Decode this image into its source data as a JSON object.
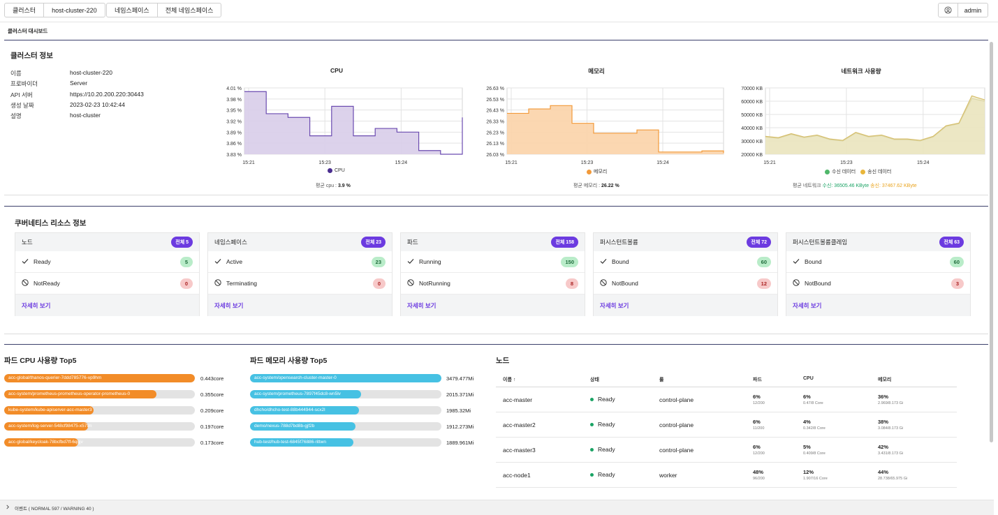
{
  "topbar": {
    "cluster_label": "클러스터",
    "cluster_value": "host-cluster-220",
    "namespace_label": "네임스페이스",
    "namespace_value": "전체 네임스페이스",
    "user_icon": "user-circle-icon",
    "user_name": "admin"
  },
  "page_subtitle": "클러스터 대시보드",
  "cluster_info": {
    "title": "클러스터 정보",
    "rows": [
      {
        "key": "이름",
        "value": "host-cluster-220"
      },
      {
        "key": "프로바이더",
        "value": "Server"
      },
      {
        "key": "API 서버",
        "value": "https://10.20.200.220:30443"
      },
      {
        "key": "생성 날짜",
        "value": "2023-02-23 10:42:44"
      },
      {
        "key": "설명",
        "value": "host-cluster"
      }
    ]
  },
  "charts": {
    "cpu": {
      "title": "CPU",
      "legend": "CPU",
      "avg_label": "평균 cpu : ",
      "avg_value": "3.9 %",
      "yticks": [
        "4.01 %",
        "3.98 %",
        "3.95 %",
        "3.92 %",
        "3.89 %",
        "3.86 %",
        "3.83 %"
      ],
      "xticks": [
        "15:21",
        "15:23",
        "15:24"
      ],
      "color": "#5b3aa0",
      "fill": "#d8cde9"
    },
    "memory": {
      "title": "메모리",
      "legend": "메모리",
      "avg_label": "평균 메모리 : ",
      "avg_value": "26.22 %",
      "yticks": [
        "26.63 %",
        "26.53 %",
        "26.43 %",
        "26.33 %",
        "26.23 %",
        "26.13 %",
        "26.03 %"
      ],
      "xticks": [
        "15:21",
        "15:23",
        "15:24"
      ],
      "color": "#f29a3a",
      "fill": "#fbd7b0"
    },
    "network": {
      "title": "네트워크 사용량",
      "legend_rx": "수신 데이터",
      "legend_tx": "송신 데이터",
      "avg_label": "평균 네트워크 ",
      "avg_rx": "수신: 36505.46 KByte",
      "avg_tx": "송신: 37467.62 KByte",
      "yticks": [
        "70000 KB",
        "60000 KB",
        "50000 KB",
        "40000 KB",
        "30000 KB",
        "20000 KB"
      ],
      "xticks": [
        "15:21",
        "15:23",
        "15:24"
      ],
      "rx_color": "#4fb76a",
      "tx_color": "#e9b63a",
      "fill": "#e7e2b9",
      "line": "#b7ad5a"
    }
  },
  "chart_data": [
    {
      "type": "area",
      "title": "CPU",
      "x": [
        "15:21",
        "15:23",
        "15:24"
      ],
      "ylim": [
        3.83,
        4.01
      ],
      "series": [
        {
          "name": "CPU",
          "values": [
            4.0,
            3.94,
            3.93,
            3.88,
            3.96,
            3.88,
            3.9,
            3.89,
            3.84,
            3.83,
            3.93
          ]
        }
      ]
    },
    {
      "type": "area",
      "title": "메모리",
      "x": [
        "15:21",
        "15:23",
        "15:24"
      ],
      "ylim": [
        26.03,
        26.63
      ],
      "series": [
        {
          "name": "메모리",
          "values": [
            26.4,
            26.44,
            26.47,
            26.31,
            26.22,
            26.22,
            26.25,
            26.05,
            26.05,
            26.06,
            26.04
          ]
        }
      ]
    },
    {
      "type": "area",
      "title": "네트워크 사용량",
      "x": [
        "15:21",
        "15:23",
        "15:24"
      ],
      "ylim": [
        20000,
        70000
      ],
      "series": [
        {
          "name": "수신 데이터",
          "values": [
            33000,
            32000,
            35000,
            32500,
            34000,
            31000,
            30000,
            36000,
            33000,
            34000,
            31000,
            31000,
            30000,
            33000,
            41000,
            43000,
            62000,
            60000
          ]
        },
        {
          "name": "송신 데이터",
          "values": [
            33500,
            32500,
            35500,
            33000,
            34500,
            31500,
            30500,
            36500,
            33500,
            34500,
            31500,
            31500,
            30500,
            33500,
            41500,
            43500,
            64000,
            61000
          ]
        }
      ]
    }
  ],
  "k8s": {
    "title": "쿠버네티스 리소스 정보",
    "detail_label": "자세히 보기",
    "cards": [
      {
        "name": "노드",
        "total": "전체 5",
        "ok_label": "Ready",
        "ok_count": "5",
        "bad_label": "NotReady",
        "bad_count": "0"
      },
      {
        "name": "네임스페이스",
        "total": "전체 23",
        "ok_label": "Active",
        "ok_count": "23",
        "bad_label": "Terminating",
        "bad_count": "0"
      },
      {
        "name": "파드",
        "total": "전체 158",
        "ok_label": "Running",
        "ok_count": "150",
        "bad_label": "NotRunning",
        "bad_count": "8"
      },
      {
        "name": "퍼시스턴트볼륨",
        "total": "전체 72",
        "ok_label": "Bound",
        "ok_count": "60",
        "bad_label": "NotBound",
        "bad_count": "12"
      },
      {
        "name": "퍼시스턴트볼륨클레임",
        "total": "전체 63",
        "ok_label": "Bound",
        "ok_count": "60",
        "bad_label": "NotBound",
        "bad_count": "3"
      }
    ]
  },
  "cpu_top5": {
    "title": "파드 CPU 사용량 Top5",
    "color": "#f28c28",
    "items": [
      {
        "name": "acc-global/thanos-querier-7ddd785776-vp9hm",
        "value": "0.443core",
        "ratio": 1.0
      },
      {
        "name": "acc-system/prometheus-prometheus-operator-prometheus-0",
        "value": "0.355core",
        "ratio": 0.8
      },
      {
        "name": "kube-system/kube-apiserver-acc-master3",
        "value": "0.209core",
        "ratio": 0.47
      },
      {
        "name": "acc-system/log-server-548cf98475-x57tm",
        "value": "0.197core",
        "ratio": 0.44
      },
      {
        "name": "acc-global/keycloak-78bcfbd7ff-6qgjv",
        "value": "0.173core",
        "ratio": 0.39
      }
    ]
  },
  "mem_top5": {
    "title": "파드 메모리 사용량 Top5",
    "color": "#46c1e3",
    "items": [
      {
        "name": "acc-system/opensearch-cluster-master-0",
        "value": "3479.477Mi",
        "ratio": 1.0
      },
      {
        "name": "acc-system/prometheus-7897f45dc8-wn5lv",
        "value": "2015.371Mi",
        "ratio": 0.58
      },
      {
        "name": "dhcho/dhcho-test-88b444944-scx2l",
        "value": "1985.32Mi",
        "ratio": 0.57
      },
      {
        "name": "demo/nexus-788d7bd8b-gjf2b",
        "value": "1912.273Mi",
        "ratio": 0.55
      },
      {
        "name": "hub-test/hub-test-6845f76886-rittwn",
        "value": "1889.961Mi",
        "ratio": 0.54
      }
    ]
  },
  "nodes": {
    "title": "노드",
    "headers": {
      "name": "이름 ↑",
      "status": "상태",
      "role": "롤",
      "pod": "파드",
      "cpu": "CPU",
      "mem": "메모리"
    },
    "rows": [
      {
        "name": "acc-master",
        "status": "Ready",
        "role": "control-plane",
        "pod_pct": "6%",
        "pod_sub": "12/200",
        "cpu_pct": "6%",
        "cpu_sub": "0.47/8 Core",
        "mem_pct": "36%",
        "mem_sub": "2.969/8.173 Gi"
      },
      {
        "name": "acc-master2",
        "status": "Ready",
        "role": "control-plane",
        "pod_pct": "6%",
        "pod_sub": "11/200",
        "cpu_pct": "4%",
        "cpu_sub": "0.342/8 Core",
        "mem_pct": "38%",
        "mem_sub": "3.084/8.173 Gi"
      },
      {
        "name": "acc-master3",
        "status": "Ready",
        "role": "control-plane",
        "pod_pct": "6%",
        "pod_sub": "12/200",
        "cpu_pct": "5%",
        "cpu_sub": "0.409/8 Core",
        "mem_pct": "42%",
        "mem_sub": "3.431/8.173 Gi"
      },
      {
        "name": "acc-node1",
        "status": "Ready",
        "role": "worker",
        "pod_pct": "48%",
        "pod_sub": "96/200",
        "cpu_pct": "12%",
        "cpu_sub": "1.907/16 Core",
        "mem_pct": "44%",
        "mem_sub": "28.738/65.975 Gi"
      }
    ]
  },
  "events": {
    "label": "이벤트 ( NORMAL 597 / WARNING 40 )"
  }
}
